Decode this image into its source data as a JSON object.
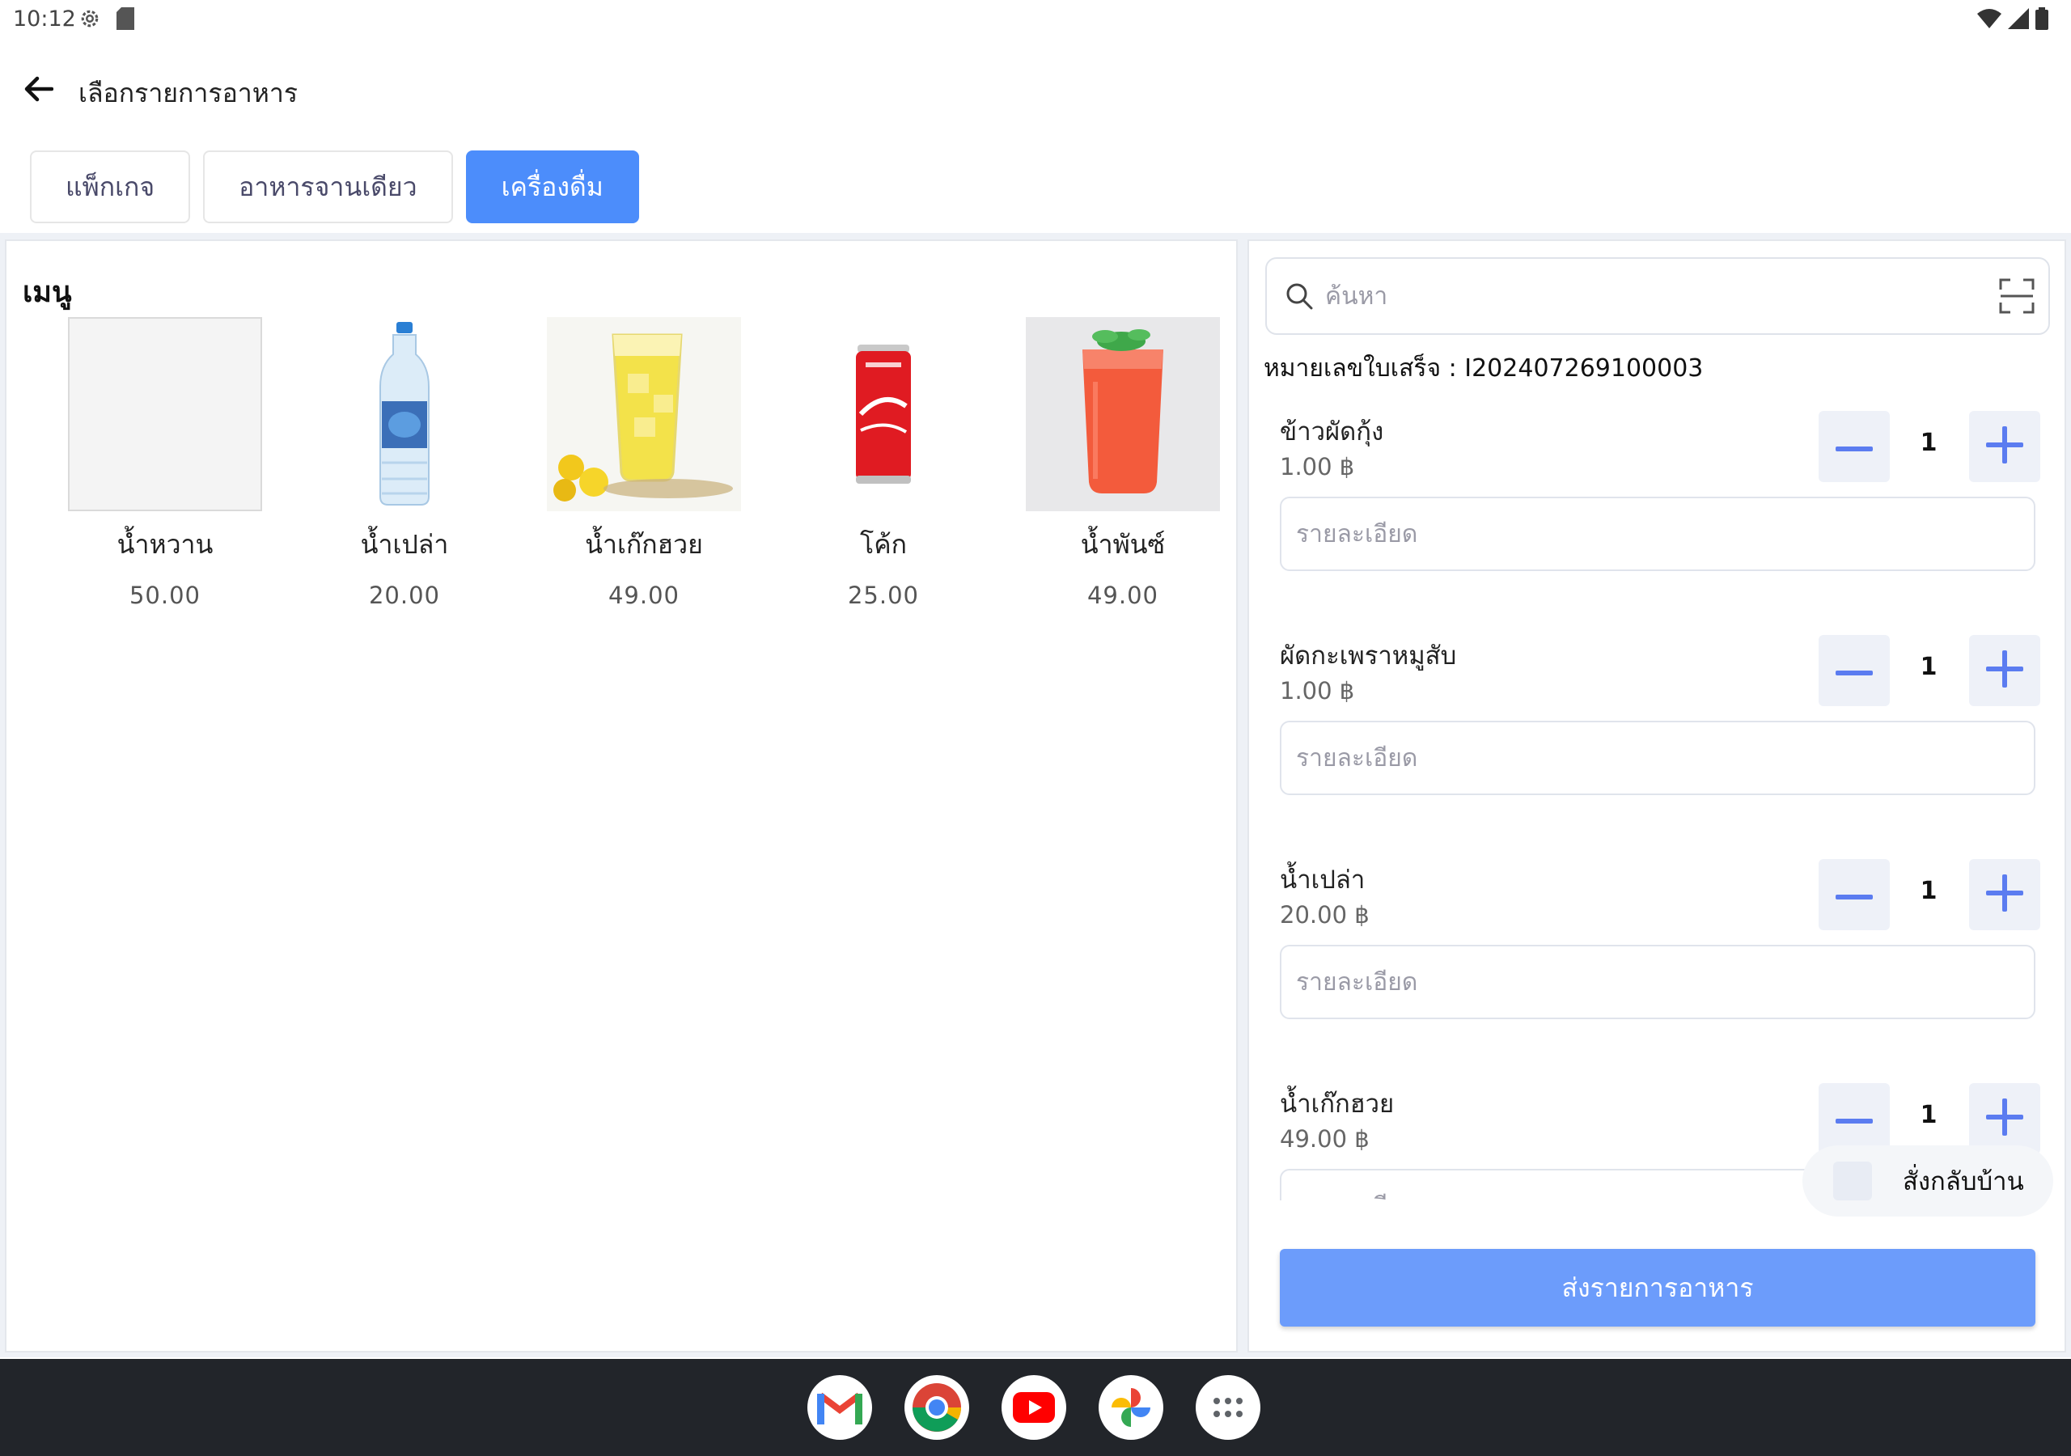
{
  "status_bar": {
    "time": "10:12",
    "icons": [
      "settings-icon",
      "sd-card-icon",
      "wifi-icon",
      "signal-icon",
      "battery-icon"
    ]
  },
  "app_bar": {
    "title": "เลือกรายการอาหาร",
    "back_icon": "arrow-left-icon"
  },
  "tabs": [
    {
      "label": "แพ็กเกจ",
      "active": false
    },
    {
      "label": "อาหารจานเดียว",
      "active": false
    },
    {
      "label": "เครื่องดื่ม",
      "active": true
    }
  ],
  "menu": {
    "title": "เมนู",
    "items": [
      {
        "name": "น้ำหวาน",
        "price": "50.00",
        "image": "blank"
      },
      {
        "name": "น้ำเปล่า",
        "price": "20.00",
        "image": "water-bottle"
      },
      {
        "name": "น้ำเก๊กฮวย",
        "price": "49.00",
        "image": "chrysanthemum-tea"
      },
      {
        "name": "โค้ก",
        "price": "25.00",
        "image": "coke-can"
      },
      {
        "name": "น้ำพันซ์",
        "price": "49.00",
        "image": "punch-drink"
      }
    ]
  },
  "order": {
    "search_placeholder": "ค้นหา",
    "receipt_label": "หมายเลขใบเสร็จ : I202407269100003",
    "detail_placeholder": "รายละเอียด",
    "items": [
      {
        "name": "ข้าวผัดกุ้ง",
        "price": "1.00 ฿",
        "qty": "1"
      },
      {
        "name": "ผัดกะเพราหมูสับ",
        "price": "1.00 ฿",
        "qty": "1"
      },
      {
        "name": "น้ำเปล่า",
        "price": "20.00 ฿",
        "qty": "1"
      },
      {
        "name": "น้ำเก๊กฮวย",
        "price": "49.00 ฿",
        "qty": "1"
      }
    ],
    "takeaway_label": "สั่งกลับบ้าน",
    "submit_label": "ส่งรายการอาหาร"
  },
  "dock": {
    "apps": [
      "gmail-icon",
      "chrome-icon",
      "youtube-icon",
      "photos-icon",
      "app-drawer-icon"
    ]
  },
  "colors": {
    "accent": "#4c8dfb",
    "submit": "#6c9cfb",
    "stepper_icon": "#5b7cf0",
    "dock_bg": "#22252a"
  }
}
